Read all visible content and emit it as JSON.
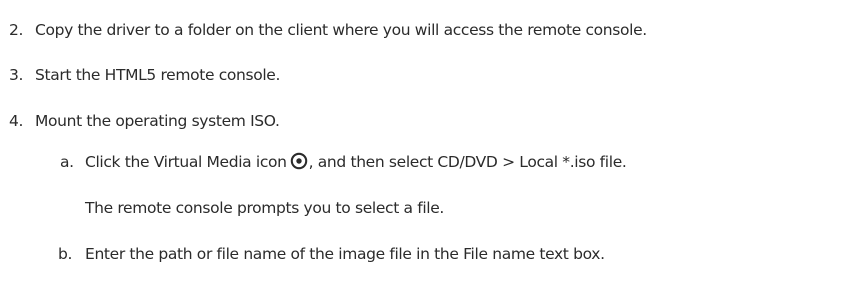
{
  "steps": [
    {
      "number": "2.",
      "text": "Copy the driver to a folder on the client where you will access the remote console."
    },
    {
      "number": "3.",
      "text": "Start the HTML5 remote console."
    },
    {
      "number": "4.",
      "text": "Mount the operating system ISO."
    }
  ],
  "substep_a": {
    "letter": "a.",
    "text_before_icon": "Click the Virtual Media icon",
    "icon": "virtual-media-icon",
    "text_after_icon": ", and then select  CD/DVD > Local *.iso file.",
    "note": "The remote console prompts you to select a file."
  },
  "substep_b": {
    "letter": "b.",
    "text": "Enter the path or file name of the image file in the  File name text box."
  },
  "colors": {
    "text": "#2b2b2b",
    "background": "#ffffff"
  }
}
